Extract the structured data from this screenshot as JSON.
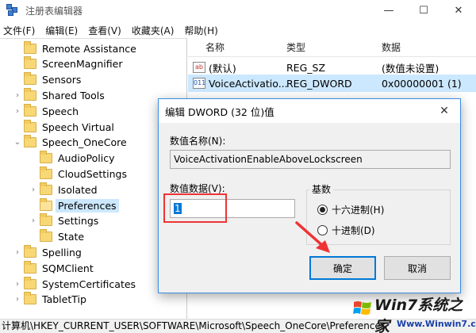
{
  "window": {
    "title": "注册表编辑器",
    "controls": [
      "—",
      "☐",
      "✕"
    ]
  },
  "menu": [
    "文件(F)",
    "编辑(E)",
    "查看(V)",
    "收藏夹(A)",
    "帮助(H)"
  ],
  "tree": [
    {
      "label": "Remote Assistance",
      "depth": 1,
      "chevron": ""
    },
    {
      "label": "ScreenMagnifier",
      "depth": 1,
      "chevron": ""
    },
    {
      "label": "Sensors",
      "depth": 1,
      "chevron": ""
    },
    {
      "label": "Shared Tools",
      "depth": 1,
      "chevron": ">"
    },
    {
      "label": "Speech",
      "depth": 1,
      "chevron": ">"
    },
    {
      "label": "Speech Virtual",
      "depth": 1,
      "chevron": ""
    },
    {
      "label": "Speech_OneCore",
      "depth": 1,
      "chevron": "v"
    },
    {
      "label": "AudioPolicy",
      "depth": 2,
      "chevron": ""
    },
    {
      "label": "CloudSettings",
      "depth": 2,
      "chevron": ""
    },
    {
      "label": "Isolated",
      "depth": 2,
      "chevron": ">"
    },
    {
      "label": "Preferences",
      "depth": 2,
      "chevron": "",
      "selected": true
    },
    {
      "label": "Settings",
      "depth": 2,
      "chevron": ">"
    },
    {
      "label": "State",
      "depth": 2,
      "chevron": ""
    },
    {
      "label": "Spelling",
      "depth": 1,
      "chevron": ">"
    },
    {
      "label": "SQMClient",
      "depth": 1,
      "chevron": ""
    },
    {
      "label": "SystemCertificates",
      "depth": 1,
      "chevron": ">"
    },
    {
      "label": "TabletTip",
      "depth": 1,
      "chevron": ">"
    }
  ],
  "columns": {
    "name": "名称",
    "type": "类型",
    "data": "数据"
  },
  "values": [
    {
      "icon": "ab",
      "name": "(默认)",
      "type": "REG_SZ",
      "data": "(数值未设置)",
      "selected": false
    },
    {
      "icon": "011",
      "name": "VoiceActivatio...",
      "type": "REG_DWORD",
      "data": "0x00000001 (1)",
      "selected": true
    }
  ],
  "status": "计算机\\HKEY_CURRENT_USER\\SOFTWARE\\Microsoft\\Speech_OneCore\\Preferences",
  "dialog": {
    "title": "编辑 DWORD (32 位)值",
    "name_label": "数值名称(N):",
    "name_value": "VoiceActivationEnableAboveLockscreen",
    "data_label": "数值数据(V):",
    "data_value": "1",
    "base_label": "基数",
    "hex_label": "十六进制(H)",
    "dec_label": "十进制(D)",
    "ok_label": "确定",
    "cancel_label": "取消",
    "close_glyph": "✕"
  },
  "watermark": {
    "main": "Win7系统之家",
    "sub": "Www.Winwin7.com"
  },
  "colors": {
    "selection": "#cce8ff",
    "accent": "#0078d7",
    "annotation": "#e33333"
  }
}
